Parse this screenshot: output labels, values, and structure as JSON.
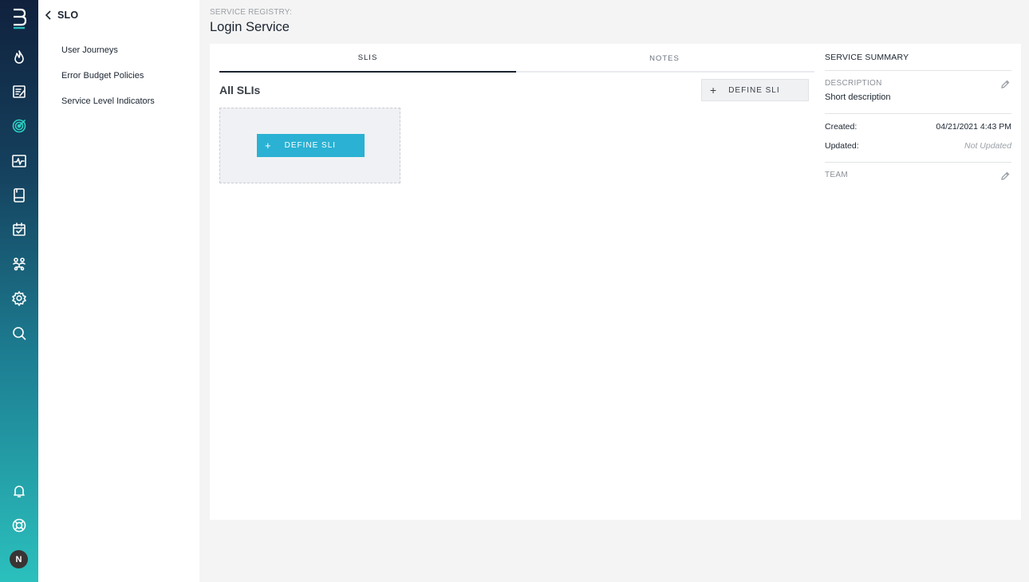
{
  "rail": {
    "logo": "B",
    "icons": [
      "flame-icon",
      "checklist-icon",
      "target-icon",
      "pulse-icon",
      "notebook-icon",
      "calendar-check-icon",
      "team-icon",
      "gear-icon",
      "search-icon"
    ],
    "bottom_icons": [
      "bell-icon",
      "lifebuoy-icon"
    ],
    "avatar_initial": "N"
  },
  "sidebar": {
    "back_label": "SLO",
    "items": [
      {
        "label": "User Journeys"
      },
      {
        "label": "Error Budget Policies"
      },
      {
        "label": "Service Level Indicators"
      }
    ]
  },
  "header": {
    "breadcrumb": "SERVICE REGISTRY:",
    "title": "Login Service"
  },
  "tabs": [
    {
      "label": "SLIS",
      "active": true
    },
    {
      "label": "NOTES",
      "active": false
    }
  ],
  "main": {
    "section_title": "All SLIs",
    "define_button_label": "DEFINE SLI",
    "empty_define_button_label": "DEFINE SLI",
    "plus_glyph": "+"
  },
  "summary": {
    "title": "SERVICE SUMMARY",
    "description_label": "DESCRIPTION",
    "description_value": "Short description",
    "created_label": "Created:",
    "created_value": "04/21/2021 4:43 PM",
    "updated_label": "Updated:",
    "updated_value": "Not Updated",
    "team_label": "TEAM"
  },
  "colors": {
    "accent": "#2ab1d3",
    "rail_top": "#10213d",
    "rail_bottom": "#2bc0bd"
  }
}
